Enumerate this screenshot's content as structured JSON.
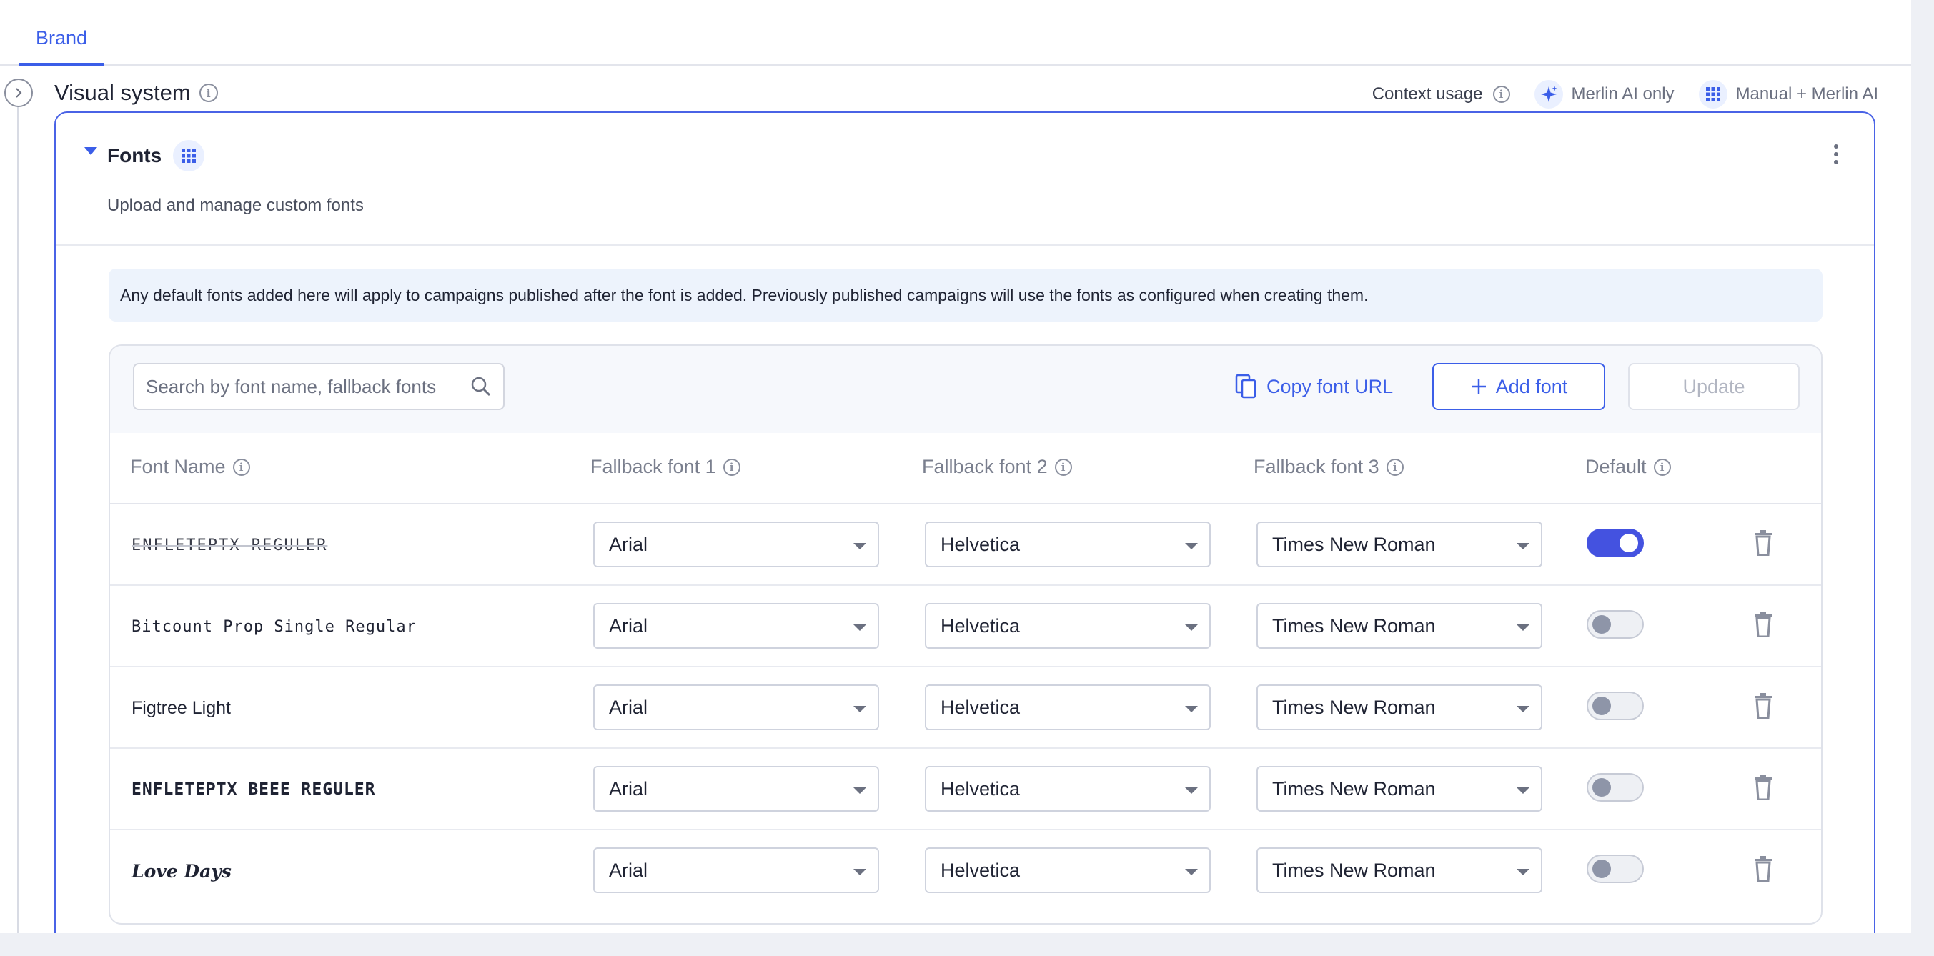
{
  "tabs": [
    {
      "label": "Brand"
    }
  ],
  "section": {
    "title": "Visual system",
    "context_usage_label": "Context usage",
    "merlin_only_label": "Merlin AI only",
    "manual_merlin_label": "Manual + Merlin AI"
  },
  "card": {
    "title": "Fonts",
    "subtitle": "Upload and manage custom fonts",
    "notice": "Any default fonts added here will apply to campaigns published after the font is added. Previously published campaigns will use the fonts as configured when creating them."
  },
  "toolbar": {
    "search_placeholder": "Search by font name, fallback fonts",
    "copy_url_label": "Copy font URL",
    "add_font_label": "Add font",
    "update_label": "Update"
  },
  "columns": {
    "font_name": "Font Name",
    "fallback1": "Fallback font 1",
    "fallback2": "Fallback font 2",
    "fallback3": "Fallback font 3",
    "default": "Default"
  },
  "rows": [
    {
      "name": "ENFLETEPTX REGULER",
      "fallback1": "Arial",
      "fallback2": "Helvetica",
      "fallback3": "Times New Roman",
      "default": true
    },
    {
      "name": "Bitcount Prop Single Regular",
      "fallback1": "Arial",
      "fallback2": "Helvetica",
      "fallback3": "Times New Roman",
      "default": false
    },
    {
      "name": "Figtree Light",
      "fallback1": "Arial",
      "fallback2": "Helvetica",
      "fallback3": "Times New Roman",
      "default": false
    },
    {
      "name": "ENFLETEPTX BEEE REGULER",
      "fallback1": "Arial",
      "fallback2": "Helvetica",
      "fallback3": "Times New Roman",
      "default": false
    },
    {
      "name": "Love Days",
      "fallback1": "Arial",
      "fallback2": "Helvetica",
      "fallback3": "Times New Roman",
      "default": false
    }
  ],
  "colors": {
    "accent": "#3b5ee8",
    "toggle_on": "#4452e0",
    "notice_bg": "#edf3fc"
  }
}
